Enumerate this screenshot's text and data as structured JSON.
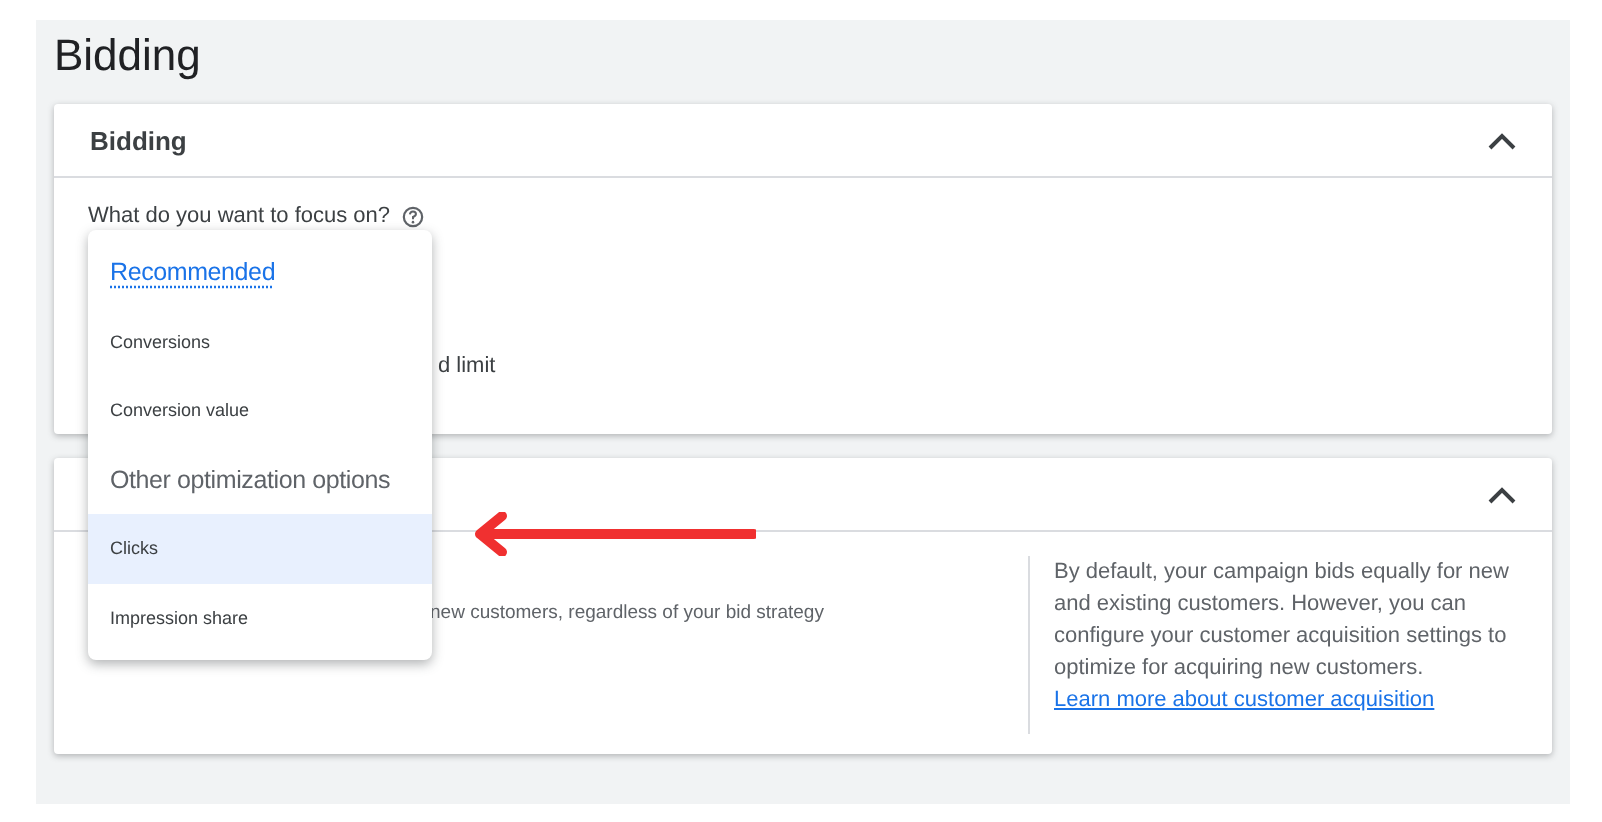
{
  "page_title": "Bidding",
  "bidding_card": {
    "title": "Bidding",
    "expanded": true,
    "question": "What do you want to focus on?",
    "partial_text": "d limit"
  },
  "dropdown": {
    "items": [
      {
        "kind": "header",
        "label": "Recommended",
        "link": true
      },
      {
        "kind": "option",
        "label": "Conversions",
        "selected": false
      },
      {
        "kind": "option",
        "label": "Conversion value",
        "selected": false
      },
      {
        "kind": "header",
        "label": "Other optimization options",
        "link": false
      },
      {
        "kind": "option",
        "label": "Clicks",
        "selected": true
      },
      {
        "kind": "option",
        "label": "Impression share",
        "selected": false
      }
    ]
  },
  "acquisition_card": {
    "expanded": true,
    "partial_text": "new customers, regardless of your bid strategy",
    "info": "By default, your campaign bids equally for new and existing customers. However, you can configure your customer acquisition settings to optimize for acquiring new customers.",
    "info_link": "Learn more about customer acquisition"
  }
}
